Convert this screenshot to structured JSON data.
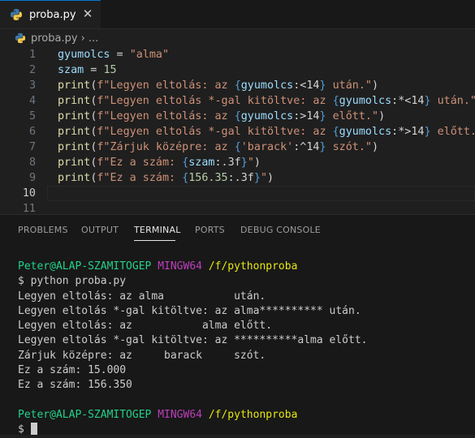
{
  "tab": {
    "label": "proba.py",
    "close": "✕"
  },
  "breadcrumb": {
    "file": "proba.py",
    "sep": "› ..."
  },
  "editor": {
    "line_numbers": [
      "1",
      "2",
      "3",
      "4",
      "5",
      "6",
      "7",
      "8",
      "9",
      "10",
      "11"
    ],
    "active_line": "10",
    "lines": [
      [
        [
          "var",
          "gyumolcs"
        ],
        [
          "op",
          " = "
        ],
        [
          "str",
          "\"alma\""
        ]
      ],
      [
        [
          "var",
          "szam"
        ],
        [
          "op",
          " = "
        ],
        [
          "num",
          "15"
        ]
      ],
      [
        [
          "fn",
          "print"
        ],
        [
          "paren",
          "("
        ],
        [
          "str",
          "f\"Legyen eltolás: az "
        ],
        [
          "brace",
          "{"
        ],
        [
          "var",
          "gyumolcs"
        ],
        [
          "fmt",
          ":<14"
        ],
        [
          "brace",
          "}"
        ],
        [
          "str",
          " után.\""
        ],
        [
          "paren",
          ")"
        ]
      ],
      [
        [
          "fn",
          "print"
        ],
        [
          "paren",
          "("
        ],
        [
          "str",
          "f\"Legyen eltolás *-gal kitöltve: az "
        ],
        [
          "brace",
          "{"
        ],
        [
          "var",
          "gyumolcs"
        ],
        [
          "fmt",
          ":*<14"
        ],
        [
          "brace",
          "}"
        ],
        [
          "str",
          " után.\""
        ],
        [
          "paren",
          ")"
        ]
      ],
      [
        [
          "fn",
          "print"
        ],
        [
          "paren",
          "("
        ],
        [
          "str",
          "f\"Legyen eltolás: az "
        ],
        [
          "brace",
          "{"
        ],
        [
          "var",
          "gyumolcs"
        ],
        [
          "fmt",
          ":>14"
        ],
        [
          "brace",
          "}"
        ],
        [
          "str",
          " előtt.\""
        ],
        [
          "paren",
          ")"
        ]
      ],
      [
        [
          "fn",
          "print"
        ],
        [
          "paren",
          "("
        ],
        [
          "str",
          "f\"Legyen eltolás *-gal kitöltve: az "
        ],
        [
          "brace",
          "{"
        ],
        [
          "var",
          "gyumolcs"
        ],
        [
          "fmt",
          ":*>14"
        ],
        [
          "brace",
          "}"
        ],
        [
          "str",
          " előtt.\""
        ],
        [
          "paren",
          ")"
        ]
      ],
      [
        [
          "fn",
          "print"
        ],
        [
          "paren",
          "("
        ],
        [
          "str",
          "f\"Zárjuk középre: az "
        ],
        [
          "brace",
          "{"
        ],
        [
          "str",
          "'barack'"
        ],
        [
          "fmt",
          ":^14"
        ],
        [
          "brace",
          "}"
        ],
        [
          "str",
          " szót.\""
        ],
        [
          "paren",
          ")"
        ]
      ],
      [
        [
          "fn",
          "print"
        ],
        [
          "paren",
          "("
        ],
        [
          "str",
          "f\"Ez a szám: "
        ],
        [
          "brace",
          "{"
        ],
        [
          "var",
          "szam"
        ],
        [
          "fmt",
          ":.3f"
        ],
        [
          "brace",
          "}"
        ],
        [
          "str",
          "\""
        ],
        [
          "paren",
          ")"
        ]
      ],
      [
        [
          "fn",
          "print"
        ],
        [
          "paren",
          "("
        ],
        [
          "str",
          "f\"Ez a szám: "
        ],
        [
          "brace",
          "{"
        ],
        [
          "num",
          "156.35"
        ],
        [
          "fmt",
          ":.3f"
        ],
        [
          "brace",
          "}"
        ],
        [
          "str",
          "\""
        ],
        [
          "paren",
          ")"
        ]
      ],
      [],
      []
    ]
  },
  "panel": {
    "tabs": [
      "PROBLEMS",
      "OUTPUT",
      "TERMINAL",
      "PORTS",
      "DEBUG CONSOLE"
    ],
    "active_tab": "TERMINAL"
  },
  "terminal": {
    "user": "Peter@ALAP-SZAMITOGEP",
    "shell": "MINGW64",
    "path": "/f/pythonproba",
    "command": "$ python proba.py",
    "output": [
      "Legyen eltolás: az alma           után.",
      "Legyen eltolás *-gal kitöltve: az alma********** után.",
      "Legyen eltolás: az           alma előtt.",
      "Legyen eltolás *-gal kitöltve: az **********alma előtt.",
      "Zárjuk középre: az     barack     szót.",
      "Ez a szám: 15.000",
      "Ez a szám: 156.350"
    ],
    "prompt": "$ "
  },
  "colors": {
    "accent": "#0078d4",
    "terminal_user": "#23d18b",
    "terminal_shell": "#bc3fbc",
    "terminal_path": "#e5e510"
  },
  "icons": {
    "file": "python-icon",
    "close": "close-icon"
  }
}
